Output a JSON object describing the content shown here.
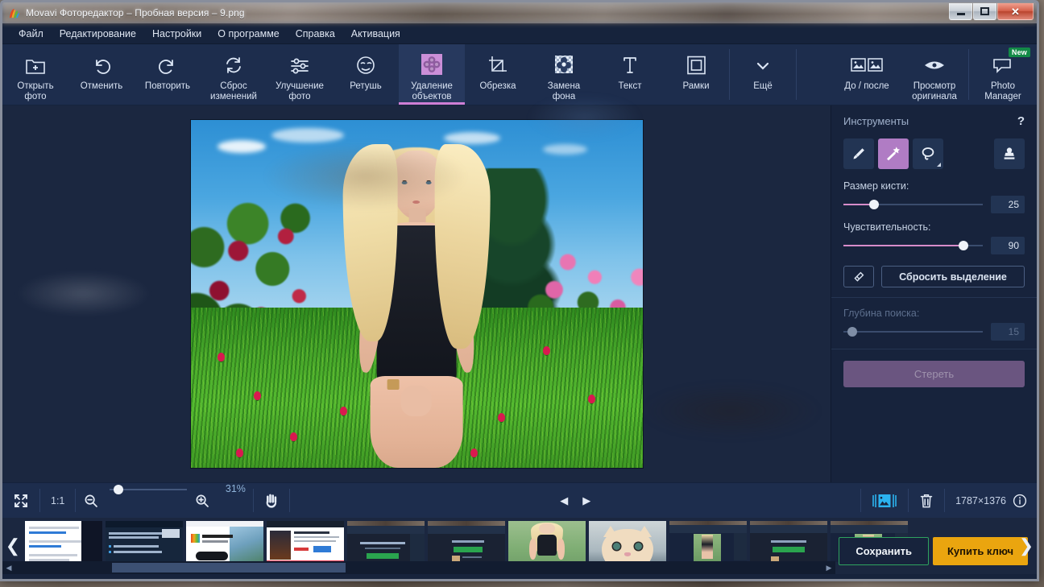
{
  "window": {
    "title": "Movavi Фоторедактор – Пробная версия – 9.png",
    "app_icon": "movavi-logo-icon",
    "controls": {
      "minimize": "minimize-icon",
      "maximize": "maximize-icon",
      "close": "✕"
    }
  },
  "menubar": {
    "items": [
      {
        "label": "Файл",
        "name": "menu-file"
      },
      {
        "label": "Редактирование",
        "name": "menu-edit"
      },
      {
        "label": "Настройки",
        "name": "menu-settings"
      },
      {
        "label": "О программе",
        "name": "menu-about"
      },
      {
        "label": "Справка",
        "name": "menu-help"
      },
      {
        "label": "Активация",
        "name": "menu-activation"
      }
    ]
  },
  "toolbar": {
    "left": [
      {
        "label": "Открыть\nфото",
        "icon": "open-photo-icon"
      },
      {
        "label": "Отменить",
        "icon": "undo-icon"
      },
      {
        "label": "Повторить",
        "icon": "redo-icon"
      },
      {
        "label": "Сброс\nизменений",
        "icon": "reset-icon"
      },
      {
        "label": "Улучшение\nфото",
        "icon": "adjust-sliders-icon"
      },
      {
        "label": "Ретушь",
        "icon": "retouch-face-icon"
      },
      {
        "label": "Удаление\nобъектов",
        "icon": "object-removal-icon"
      },
      {
        "label": "Обрезка",
        "icon": "crop-icon"
      },
      {
        "label": "Замена\nфона",
        "icon": "background-change-icon"
      },
      {
        "label": "Текст",
        "icon": "text-icon"
      },
      {
        "label": "Рамки",
        "icon": "frames-icon"
      },
      {
        "label": "Ещё",
        "icon": "chevron-down-icon"
      }
    ],
    "active_index": 6,
    "right": [
      {
        "label": "До / после",
        "icon": "before-after-icon"
      },
      {
        "label": "Просмотр\nоригинала",
        "icon": "eye-icon"
      },
      {
        "label": "Photo\nManager",
        "icon": "photo-manager-icon",
        "badge": "New"
      }
    ]
  },
  "right_panel": {
    "title": "Инструменты",
    "help": "?",
    "tools": [
      {
        "name": "brush-tool",
        "icon": "brush-icon",
        "selected": false
      },
      {
        "name": "magic-wand-tool",
        "icon": "magic-wand-icon",
        "selected": true
      },
      {
        "name": "lasso-tool",
        "icon": "lasso-icon",
        "selected": false
      },
      {
        "name": "stamp-tool",
        "icon": "stamp-icon",
        "selected": false
      }
    ],
    "brush_size": {
      "label": "Размер кисти:",
      "value": "25",
      "percent": 22
    },
    "sensitivity": {
      "label": "Чувствительность:",
      "value": "90",
      "percent": 88
    },
    "eraser_button": {
      "icon": "eraser-icon"
    },
    "reset_selection": "Сбросить выделение",
    "search_depth": {
      "label": "Глубина поиска:",
      "value": "15",
      "percent": 7,
      "disabled": true
    },
    "erase_button": "Стереть"
  },
  "bottom_bar": {
    "fit_icon": "fit-to-screen-icon",
    "actual_size": "1:1",
    "zoom_out_icon": "zoom-out-icon",
    "zoom_in_icon": "zoom-in-icon",
    "zoom_level": "31%",
    "hand_icon": "hand-tool-icon",
    "prev_icon": "◀",
    "next_icon": "▶",
    "filmstrip_toggle_icon": "filmstrip-toggle-icon",
    "delete_icon": "trash-icon",
    "dimensions": "1787×1376",
    "info_icon": "info-icon"
  },
  "filmstrip": {
    "prev_arrow": "❮",
    "next_arrow": "❯",
    "thumbnails": [
      {
        "name": "thumbnail-doc-1",
        "kind": "doc-text",
        "selected": false
      },
      {
        "name": "thumbnail-doc-2",
        "kind": "doc-installer",
        "selected": false
      },
      {
        "name": "thumbnail-landing-page",
        "kind": "landing",
        "selected": false
      },
      {
        "name": "thumbnail-store-page",
        "kind": "store",
        "selected": false
      },
      {
        "name": "thumbnail-app-dark-1",
        "kind": "app-dark",
        "selected": false
      },
      {
        "name": "thumbnail-app-dark-2",
        "kind": "app-dark2",
        "selected": false
      },
      {
        "name": "thumbnail-portrait-blonde",
        "kind": "portrait",
        "selected": true
      },
      {
        "name": "thumbnail-cat",
        "kind": "cat",
        "selected": false
      },
      {
        "name": "thumbnail-app-editor-1",
        "kind": "app-editor",
        "selected": false
      },
      {
        "name": "thumbnail-app-dark-3",
        "kind": "app-dark3",
        "selected": false
      },
      {
        "name": "thumbnail-app-editor-2",
        "kind": "app-editor2",
        "selected": false
      }
    ]
  },
  "actions": {
    "save": "Сохранить",
    "buy_key": "Купить ключ"
  },
  "scrollbar": {
    "left_arrow": "◀",
    "right_arrow": "▶"
  },
  "colors": {
    "accent_purple": "#b07cc4",
    "panel_bg": "#17233c",
    "toolbar_bg": "#1d2d4d",
    "canvas_bg": "#1b2740",
    "slider_fill": "#d68cc9",
    "buy_button": "#eaa50f",
    "save_border": "#2fa25f",
    "selection_blue": "#29a9e8",
    "badge_green": "#138a47"
  }
}
